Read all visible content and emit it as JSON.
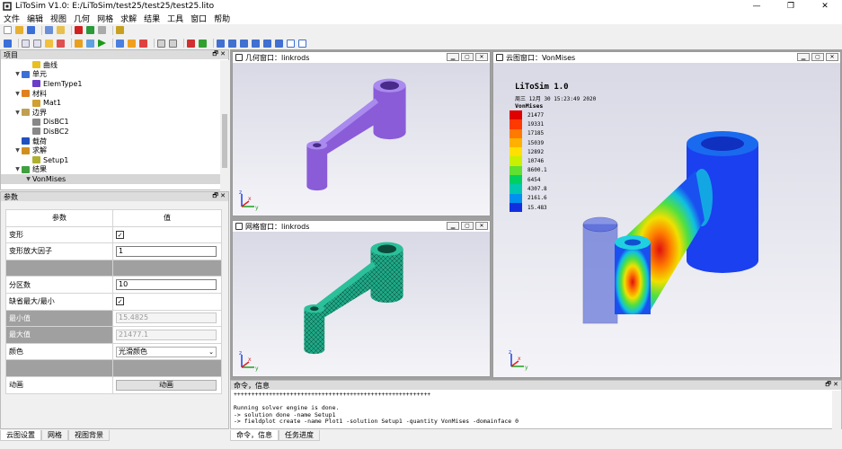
{
  "window": {
    "title": "LiToSim V1.0: E:/LiToSim/test25/test25/test25.lito",
    "minimize": "—",
    "maximize": "❐",
    "close": "✕"
  },
  "menu": [
    "文件",
    "编辑",
    "视图",
    "几何",
    "网格",
    "求解",
    "结果",
    "工具",
    "窗口",
    "帮助"
  ],
  "project_panel": {
    "title": "项目",
    "items": [
      {
        "label": "曲线",
        "level": 1,
        "expanded": null,
        "icon_color": "#e8c020"
      },
      {
        "label": "单元",
        "level": 0,
        "expanded": true,
        "icon_color": "#3a6fd8"
      },
      {
        "label": "ElemType1",
        "level": 1,
        "expanded": null,
        "icon_color": "#6a3fc8"
      },
      {
        "label": "材料",
        "level": 0,
        "expanded": true,
        "icon_color": "#e08020"
      },
      {
        "label": "Mat1",
        "level": 1,
        "expanded": null,
        "icon_color": "#d0a030"
      },
      {
        "label": "边界",
        "level": 0,
        "expanded": true,
        "icon_color": "#c0a050"
      },
      {
        "label": "DisBC1",
        "level": 1,
        "expanded": null,
        "icon_color": "#888888"
      },
      {
        "label": "DisBC2",
        "level": 1,
        "expanded": null,
        "icon_color": "#888888"
      },
      {
        "label": "载荷",
        "level": 0,
        "expanded": null,
        "icon_color": "#2050c0"
      },
      {
        "label": "求解",
        "level": 0,
        "expanded": true,
        "icon_color": "#d09020"
      },
      {
        "label": "Setup1",
        "level": 1,
        "expanded": null,
        "icon_color": "#b0b030"
      },
      {
        "label": "结果",
        "level": 0,
        "expanded": true,
        "icon_color": "#40a040"
      },
      {
        "label": "VonMises",
        "level": 1,
        "expanded": true,
        "icon_color": null,
        "selected": true
      }
    ]
  },
  "params_panel": {
    "title": "参数",
    "header": {
      "param": "参数",
      "value": "值"
    },
    "rows": [
      {
        "label": "变形",
        "type": "check",
        "value": "✓"
      },
      {
        "label": "变形放大因子",
        "type": "input",
        "value": "1"
      },
      {
        "label": "",
        "type": "gray",
        "value": ""
      },
      {
        "label": "分区数",
        "type": "input",
        "value": "10"
      },
      {
        "label": "缺省最大/最小",
        "type": "check",
        "value": "✓"
      },
      {
        "label": "最小值",
        "type": "disabled",
        "value": "15.4825",
        "gray": true
      },
      {
        "label": "最大值",
        "type": "disabled",
        "value": "21477.1",
        "gray": true
      },
      {
        "label": "颜色",
        "type": "select",
        "value": "光滑颜色"
      },
      {
        "label": "",
        "type": "gray",
        "value": ""
      },
      {
        "label": "动画",
        "type": "button",
        "value": "动画"
      }
    ]
  },
  "left_tabs": [
    "云图设置",
    "网格",
    "视图背景"
  ],
  "geo_window": {
    "title": "几何窗口：linkrods",
    "color": "#8a5cd8"
  },
  "mesh_window": {
    "title": "网格窗口：linkrods",
    "color": "#1a9c7c"
  },
  "cloud_window": {
    "title": "云图窗口：VonMises",
    "header": "LiToSim 1.0",
    "date": "周三 12月 30 15:23:49 2020",
    "var": "VonMises"
  },
  "legend": {
    "labels": [
      "21477",
      "19331",
      "17185",
      "15039",
      "12892",
      "10746",
      "8600.1",
      "6454",
      "4307.8",
      "2161.6",
      "15.483"
    ],
    "colors": [
      "#e00000",
      "#ff3a00",
      "#ff7a00",
      "#ffb000",
      "#ffe000",
      "#c8f000",
      "#60e030",
      "#00d060",
      "#00c8b0",
      "#0090f0",
      "#1030e0"
    ]
  },
  "console": {
    "title": "命令，信息",
    "lines": [
      "++++++++++++++++++++++++++++++++++++++++++++++++++++++++",
      "",
      "Running solver engine is done.",
      "-> solution done -name Setup1",
      "-> fieldplot create -name Plot1 -solution Setup1 -quantity VonMises -domainface 0"
    ]
  },
  "console_tabs": [
    "命令，信息",
    "任务进度"
  ],
  "axes": {
    "x": "x",
    "y": "y",
    "z": "z"
  },
  "dock_float": "🗗",
  "dock_close": "✕"
}
